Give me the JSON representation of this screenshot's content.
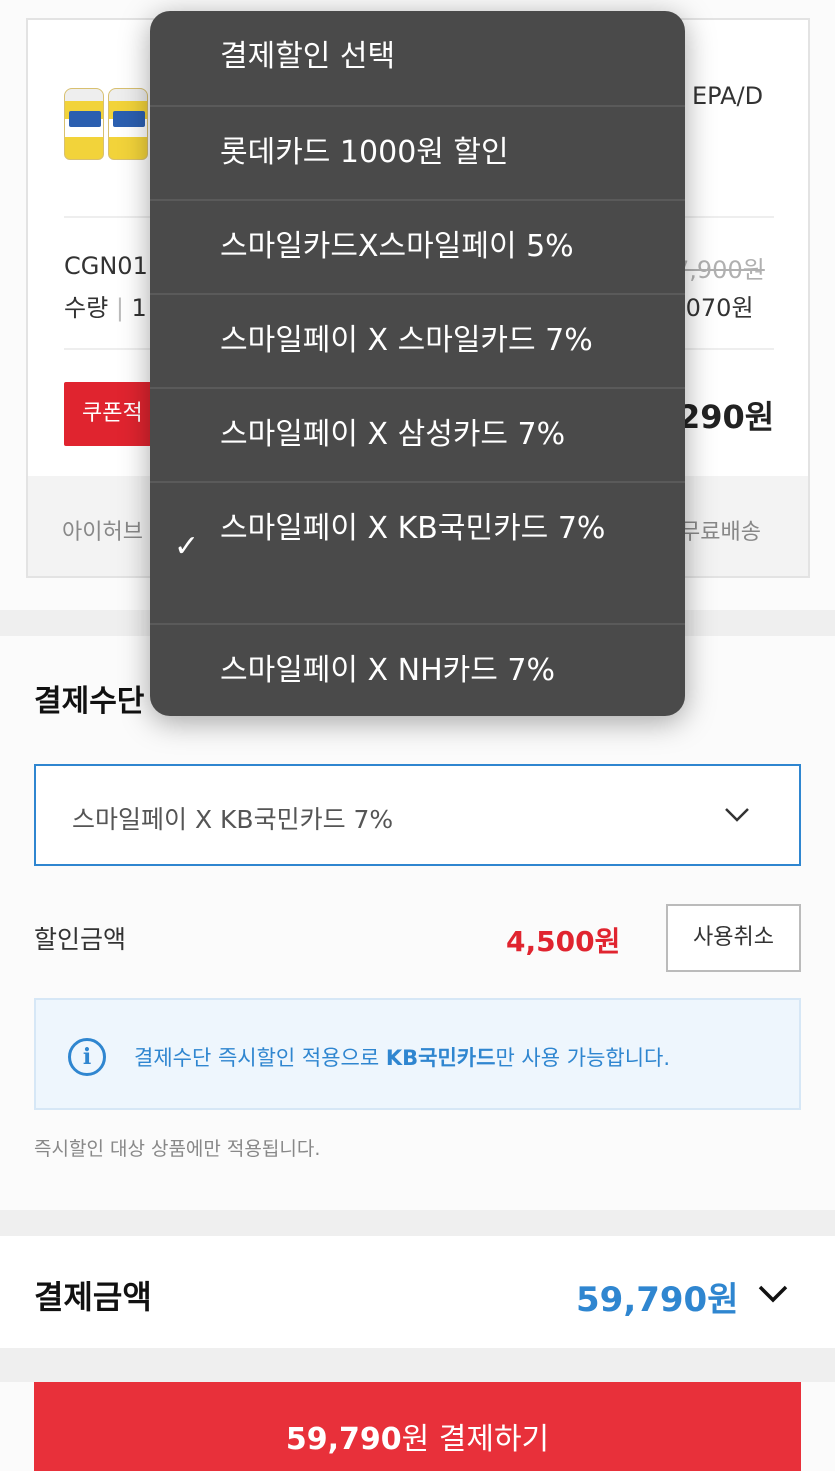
{
  "product": {
    "title_partial": "EPA/D",
    "code_partial": "CGN01",
    "qty_label": "수량",
    "qty_value": "1",
    "price_original": "7,900원",
    "price_discounted": ",070원",
    "coupon_button": "쿠폰적",
    "total_partial": "290원",
    "shipping_left": "아이허브",
    "shipping_right": "무료배송"
  },
  "payment_method": {
    "heading": "결제수단",
    "selected_value": "스마일페이 X KB국민카드 7%"
  },
  "discount": {
    "label": "할인금액",
    "amount": "4,500원",
    "cancel_button": "사용취소"
  },
  "info": {
    "text_before": "결제수단 즉시할인 적용으로 ",
    "text_bold": "KB국민카드",
    "text_after": "만 사용 가능합니다.",
    "note": "즉시할인 대상 상품에만 적용됩니다."
  },
  "total": {
    "label": "결제금액",
    "amount": "59,790원"
  },
  "checkout": {
    "amount": "59,790",
    "suffix": "원 결제하기"
  },
  "popup": {
    "options": [
      {
        "label": "결제할인 선택",
        "selected": false
      },
      {
        "label": "롯데카드 1000원 할인",
        "selected": false
      },
      {
        "label": "스마일카드X스마일페이 5%",
        "selected": false
      },
      {
        "label": "스마일페이 X 스마일카드 7%",
        "selected": false
      },
      {
        "label": "스마일페이 X 삼성카드 7%",
        "selected": false
      },
      {
        "label": "스마일페이 X KB국민카드 7%",
        "selected": true
      },
      {
        "label": "스마일페이 X NH카드 7%",
        "selected": false
      }
    ],
    "check_glyph": "✓"
  },
  "colors": {
    "accent_blue": "#2f86d0",
    "accent_red": "#e0242f",
    "popup_bg": "#4a4a4a"
  }
}
